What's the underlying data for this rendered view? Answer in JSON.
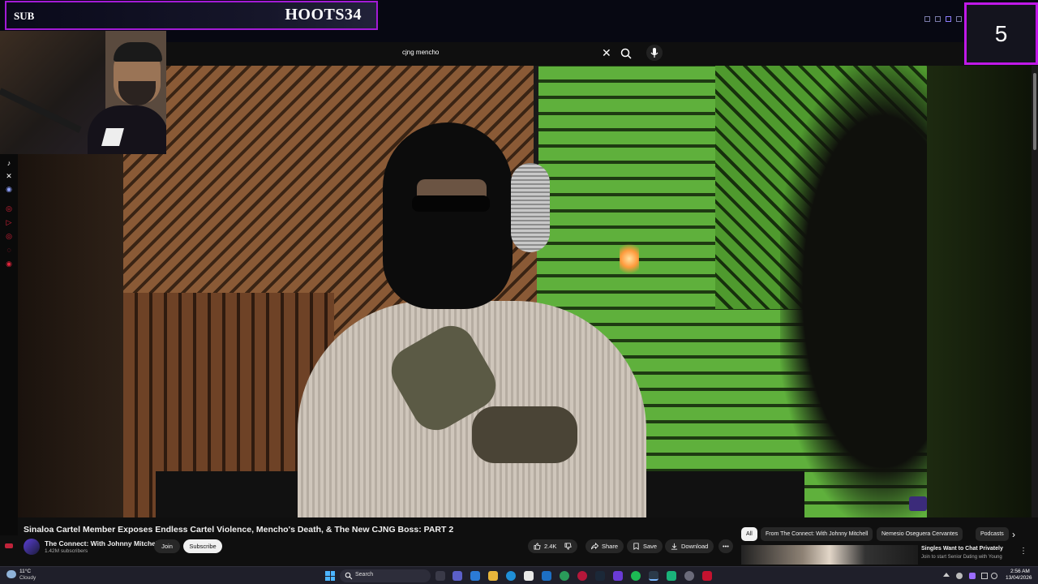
{
  "overlay": {
    "sub_label": "SUB",
    "streamer_name": "HOOTS34",
    "counter_value": "5",
    "accent_color": "#c019e8"
  },
  "search": {
    "query": "cjng mencho"
  },
  "video": {
    "title": "Sinaloa Cartel Member Exposes Endless Cartel Violence, Mencho's Death, & The New CJNG Boss: PART 2",
    "channel_name": "The Connect: With Johnny Mitchell",
    "subscriber_count": "1.42M subscribers",
    "join_label": "Join",
    "subscribe_label": "Subscribe",
    "like_count": "2.4K",
    "share_label": "Share",
    "save_label": "Save",
    "download_label": "Download"
  },
  "chips": [
    "All",
    "From The Connect: With Johnny Mitchell",
    "Nemesio Oseguera Cervantes",
    "Podcasts"
  ],
  "suggestion": {
    "title": "Singles Want to Chat Privately",
    "subtitle": "Join to start Senior Dating with Young"
  },
  "taskbar": {
    "weather_temp": "11°C",
    "weather_desc": "Cloudy",
    "search_label": "Search",
    "time": "2:56 AM",
    "date": "13/04/2026"
  },
  "icons": {
    "social": [
      "tiktok-icon",
      "x-icon",
      "discord-icon"
    ],
    "stream": [
      "record-icon",
      "play-icon",
      "record-icon",
      "stack-icon",
      "target-icon"
    ]
  }
}
